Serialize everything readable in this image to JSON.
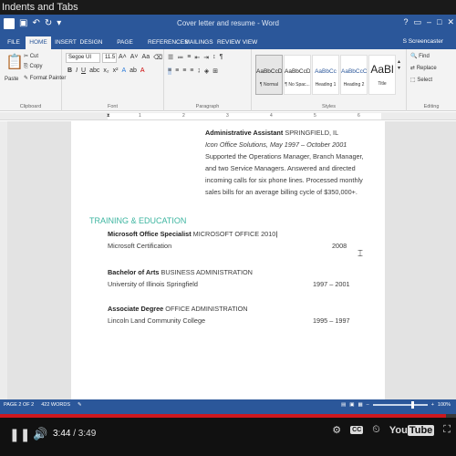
{
  "video": {
    "title": "Indents and Tabs",
    "current_time": "3:44",
    "duration": "/ 3:49",
    "progress_fraction": 0.978,
    "icons": [
      "pause-icon",
      "volume-icon",
      "settings-icon",
      "captions-icon",
      "youtube-logo",
      "fullscreen-icon"
    ]
  },
  "word": {
    "doc_title": "Cover letter and resume - Word",
    "user": "S Screencaster",
    "tabs": [
      "FILE",
      "HOME",
      "INSERT",
      "DESIGN",
      "PAGE LAYOUT",
      "REFERENCES",
      "MAILINGS",
      "REVIEW",
      "VIEW"
    ],
    "active_tab": "HOME",
    "ribbon": {
      "clipboard": {
        "label": "Clipboard",
        "paste": "Paste",
        "cut": "Cut",
        "copy": "Copy",
        "format_painter": "Format Painter"
      },
      "font": {
        "label": "Font",
        "font_name": "Segoe UI",
        "font_size": "11.5"
      },
      "paragraph": {
        "label": "Paragraph"
      },
      "styles": {
        "label": "Styles",
        "items": [
          {
            "sample": "AaBbCcDc",
            "name": "¶ Normal"
          },
          {
            "sample": "AaBbCcDc",
            "name": "¶ No Spac..."
          },
          {
            "sample": "AaBbCc",
            "name": "Heading 1"
          },
          {
            "sample": "AaBbCcC",
            "name": "Heading 2"
          },
          {
            "sample": "AaBl",
            "name": "Title"
          }
        ]
      },
      "editing": {
        "label": "Editing",
        "find": "Find",
        "replace": "Replace",
        "select": "Select"
      }
    },
    "ruler_numbers": [
      "1",
      "2",
      "3",
      "4",
      "5",
      "6"
    ],
    "document": {
      "job_title": "Administrative Assistant",
      "job_location": "SPRINGFIELD, IL",
      "job_company": "Icon Office Solutions, May 1997 – October 2001",
      "job_desc": [
        "Supported the Operations Manager, Branch Manager,",
        "and two Service Managers. Answered and directed",
        "incoming calls for six phone lines. Processed monthly",
        "sales bills for an average billing cycle of $350,000+."
      ],
      "section_heading": "TRAINING & EDUCATION",
      "education": [
        {
          "degree": "Microsoft Office Specialist",
          "field": "MICROSOFT OFFICE 2010",
          "school": "Microsoft Certification",
          "years": "2008"
        },
        {
          "degree": "Bachelor of Arts",
          "field": "BUSINESS ADMINISTRATION",
          "school": "University of Illinois Springfield",
          "years": "1997 – 2001"
        },
        {
          "degree": "Associate Degree",
          "field": "OFFICE ADMINISTRATION",
          "school": "Lincoln Land Community College",
          "years": "1995 – 1997"
        }
      ]
    },
    "status": {
      "page": "PAGE 2 OF 2",
      "words": "422 WORDS",
      "zoom": "100%"
    }
  }
}
